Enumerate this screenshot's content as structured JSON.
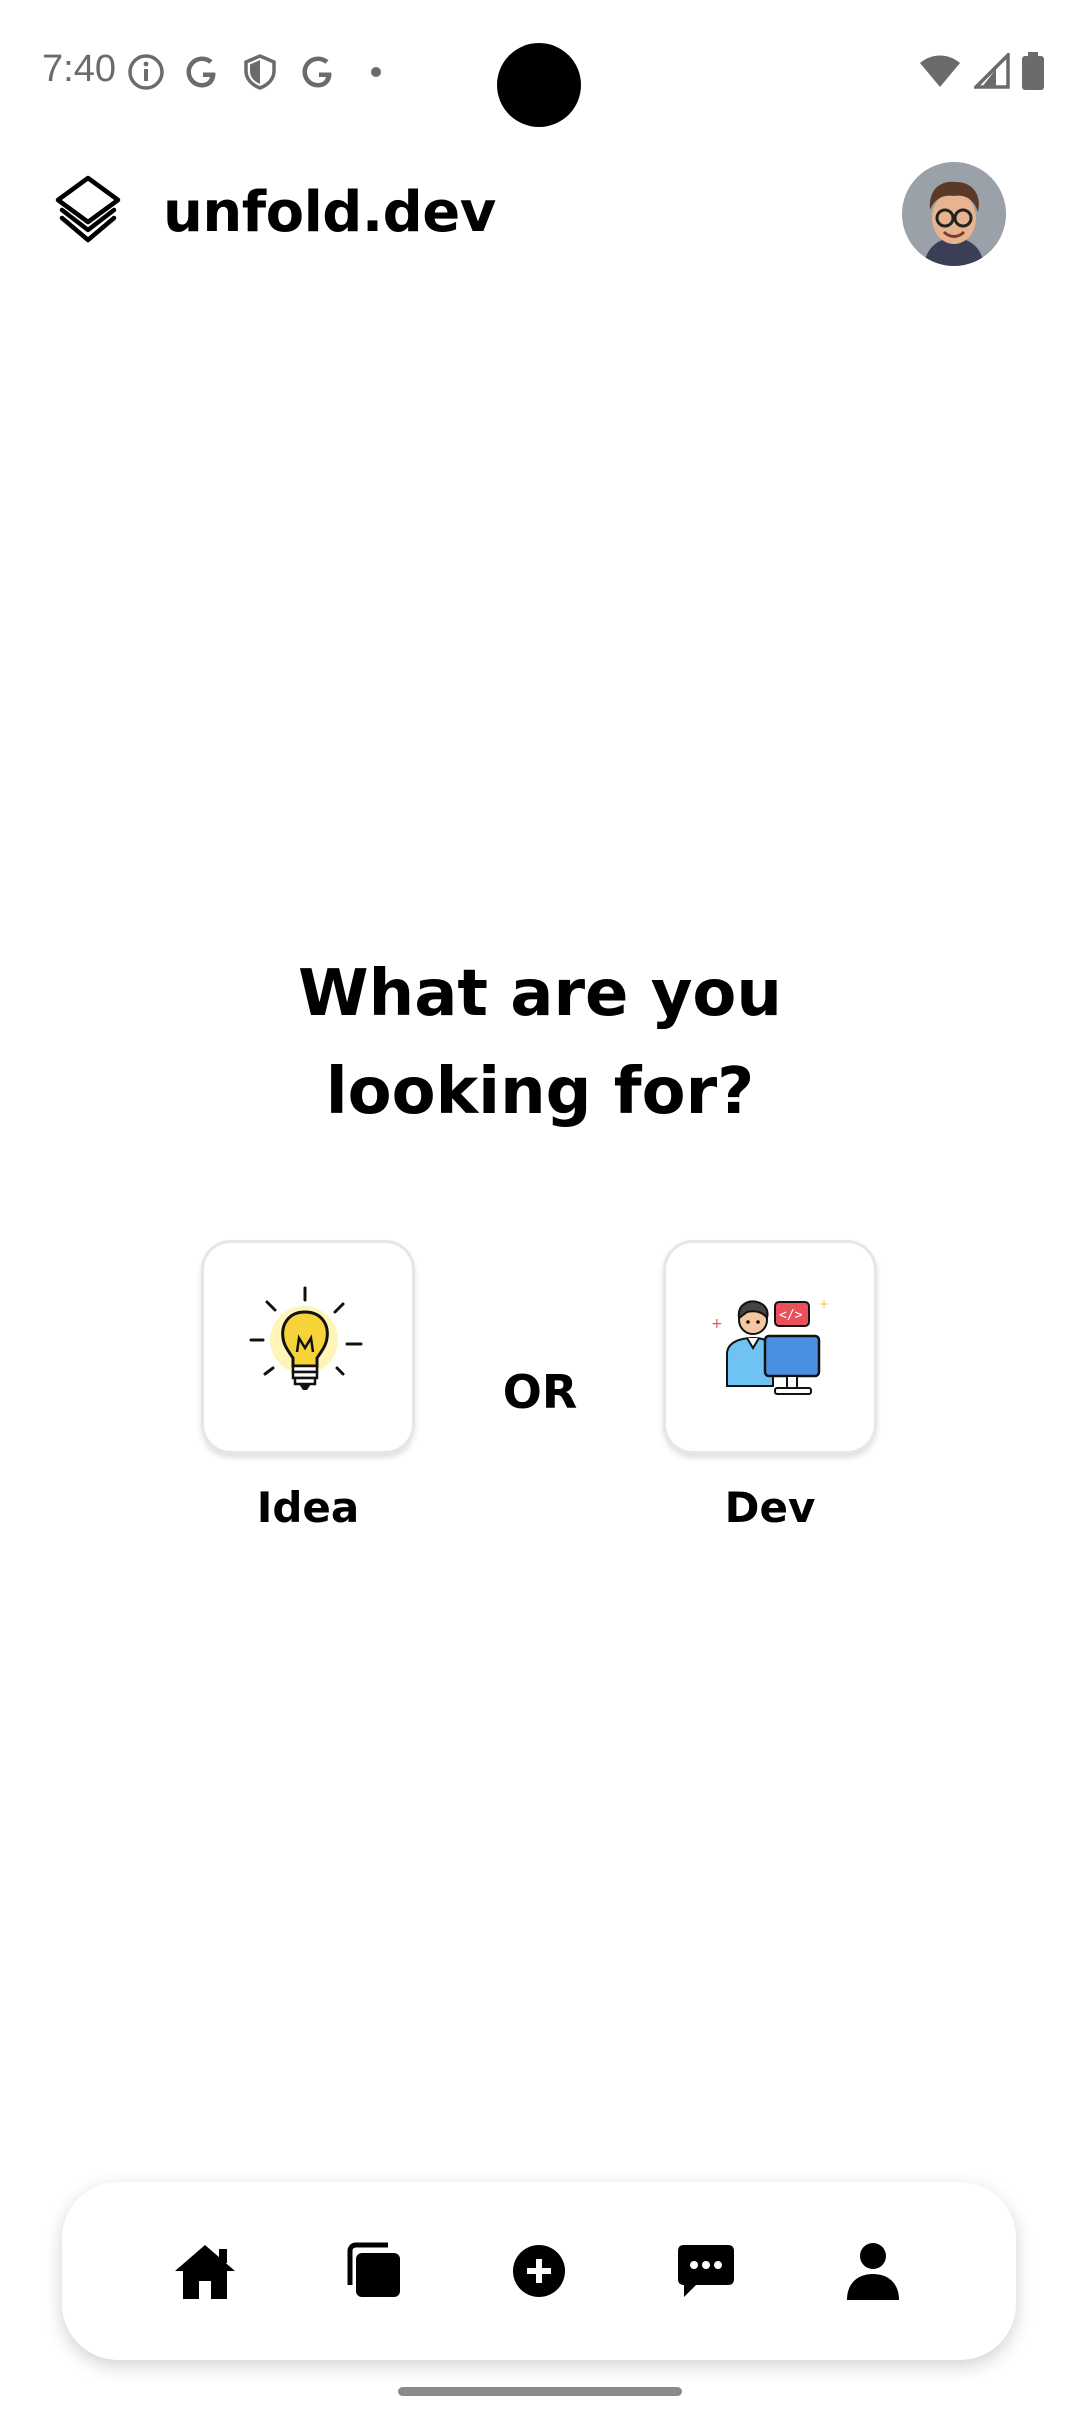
{
  "status_bar": {
    "time": "7:40",
    "left_icons": [
      "info-icon",
      "google-icon",
      "shield-icon",
      "google-icon",
      "dot-icon"
    ],
    "right_icons": [
      "wifi-icon",
      "signal-icon",
      "battery-icon"
    ]
  },
  "app_bar": {
    "logo_icon": "layers-icon",
    "title": "unfold.dev",
    "avatar_icon": "avatar"
  },
  "main": {
    "question_line1": "What are you",
    "question_line2": "looking for?",
    "or_text": "OR",
    "choices": [
      {
        "label": "Idea",
        "icon": "lightbulb-icon"
      },
      {
        "label": "Dev",
        "icon": "developer-icon"
      }
    ]
  },
  "bottom_nav": {
    "items": [
      "home-icon",
      "collection-icon",
      "add-icon",
      "chat-icon",
      "profile-icon"
    ]
  },
  "colors": {
    "background": "#ffffff",
    "text": "#000000",
    "status_text": "#6b6b6b",
    "bulb_yellow": "#F7D33A",
    "dev_blue": "#4A90E2",
    "code_red": "#E8505B"
  }
}
